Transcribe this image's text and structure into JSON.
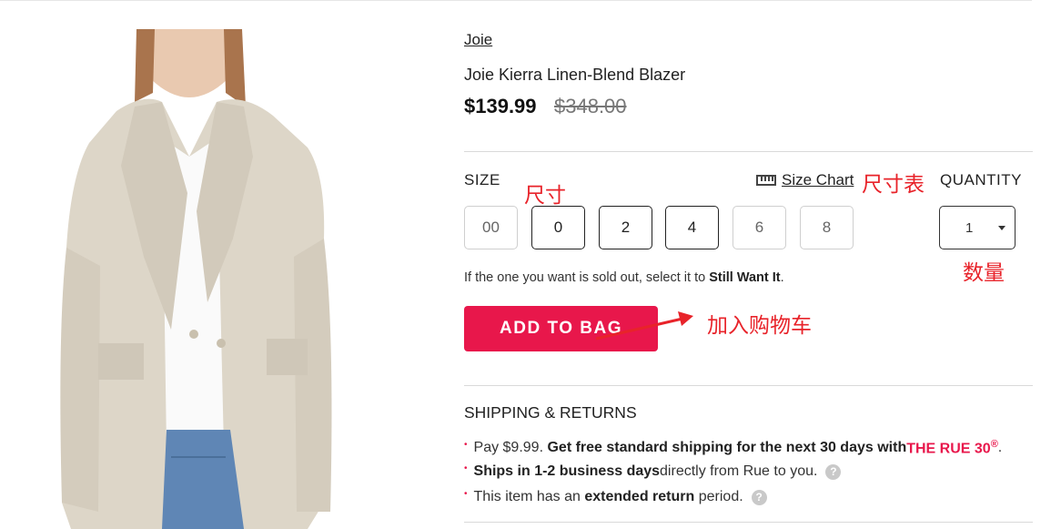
{
  "product": {
    "brand": "Joie",
    "title": "Joie Kierra Linen-Blend Blazer",
    "price": "$139.99",
    "original_price": "$348.00"
  },
  "size": {
    "label": "SIZE",
    "chart_label": "Size Chart",
    "options": [
      {
        "label": "00",
        "available": false
      },
      {
        "label": "0",
        "available": true
      },
      {
        "label": "2",
        "available": true
      },
      {
        "label": "4",
        "available": true
      },
      {
        "label": "6",
        "available": false
      },
      {
        "label": "8",
        "available": false
      }
    ]
  },
  "quantity": {
    "label": "QUANTITY",
    "value": "1"
  },
  "helper": {
    "prefix": "If the one you want is sold out, select it to ",
    "bold": "Still Want It",
    "suffix": "."
  },
  "cta": {
    "add_to_bag": "ADD TO BAG"
  },
  "shipping": {
    "title": "SHIPPING & RETURNS",
    "line1": {
      "a": "Pay $9.99. ",
      "b": "Get free standard shipping for the next 30 days with ",
      "rue": "THE RUE 30",
      "reg": "®",
      "end": "."
    },
    "line2": {
      "b": "Ships in 1-2 business days",
      "a": " directly from Rue to you."
    },
    "line3": {
      "a": "This item has an ",
      "b": "extended return",
      "c": " period."
    }
  },
  "annotations": {
    "size": "尺寸",
    "size_chart": "尺寸表",
    "quantity": "数量",
    "add_to_cart": "加入购物车"
  },
  "colors": {
    "accent": "#e8174b",
    "annotation": "#e8232a"
  },
  "icons": [
    "ruler-icon",
    "caret-down-icon",
    "help-icon",
    "arrow-icon"
  ]
}
